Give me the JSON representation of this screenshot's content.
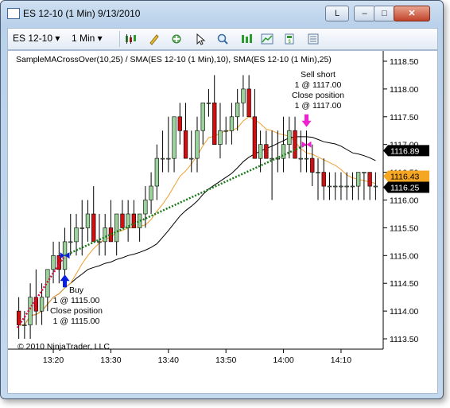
{
  "window": {
    "title": "ES 12-10 (1 Min)  9/13/2010",
    "link_label": "L",
    "min_label": "–",
    "max_label": "□",
    "close_label": "✕"
  },
  "toolbar": {
    "instrument": "ES 12-10",
    "interval": "1 Min",
    "icons": [
      "bar-type-icon",
      "pen-icon",
      "indicator-icon",
      "cursor-icon",
      "zoom-icon",
      "strategy-icon",
      "chart-icon",
      "properties-icon"
    ]
  },
  "chart": {
    "indicator_label": "SampleMACrossOver(10,25) / SMA(ES 12-10 (1 Min),10), SMA(ES 12-10 (1 Min),25)",
    "copyright": "© 2010 NinjaTrader, LLC",
    "buy_text": [
      "Buy",
      "1 @ 1115.00",
      "Close position",
      "1 @ 1115.00"
    ],
    "sell_text": [
      "Sell short",
      "1 @ 1117.00",
      "Close position",
      "1 @ 1117.00"
    ],
    "x_tick_labels": [
      "13:20",
      "13:30",
      "13:40",
      "13:50",
      "14:00",
      "14:10"
    ],
    "y_tick_labels": [
      "1118.50",
      "1118.00",
      "1117.50",
      "1117.00",
      "1116.50",
      "1116.00",
      "1115.50",
      "1115.00",
      "1114.50",
      "1114.00",
      "1113.50"
    ],
    "price_markers": [
      {
        "label": "1116.89",
        "value": 1116.89,
        "color": "#000000",
        "text_color": "#ffffff"
      },
      {
        "label": "1116.43",
        "value": 1116.43,
        "color": "#f5a623",
        "text_color": "#000000"
      },
      {
        "label": "1116.25",
        "value": 1116.25,
        "color": "#000000",
        "text_color": "#ffffff"
      }
    ],
    "colors": {
      "up": "#9bd19b",
      "down": "#d01010",
      "sma_fast": "#f0a030",
      "sma_slow": "#000000",
      "entry_line": "#1a7a1a",
      "exit_line": "#d01040",
      "buy_arrow": "#0a1ee0",
      "sell_arrow": "#f020d0"
    }
  },
  "chart_data": {
    "type": "candlestick",
    "title": "",
    "xlabel": "",
    "ylabel": "",
    "y_axis_range": [
      1113.4,
      1118.6
    ],
    "x_time_range": [
      "13:14",
      "14:17"
    ],
    "x": [
      "13:14",
      "13:15",
      "13:16",
      "13:17",
      "13:18",
      "13:19",
      "13:20",
      "13:21",
      "13:22",
      "13:23",
      "13:24",
      "13:25",
      "13:26",
      "13:27",
      "13:28",
      "13:29",
      "13:30",
      "13:31",
      "13:32",
      "13:33",
      "13:34",
      "13:35",
      "13:36",
      "13:37",
      "13:38",
      "13:39",
      "13:40",
      "13:41",
      "13:42",
      "13:43",
      "13:44",
      "13:45",
      "13:46",
      "13:47",
      "13:48",
      "13:49",
      "13:50",
      "13:51",
      "13:52",
      "13:53",
      "13:54",
      "13:55",
      "13:56",
      "13:57",
      "13:58",
      "13:59",
      "14:00",
      "14:01",
      "14:02",
      "14:03",
      "14:04",
      "14:05",
      "14:06",
      "14:07",
      "14:08",
      "14:09",
      "14:10",
      "14:11",
      "14:12",
      "14:13",
      "14:14",
      "14:15",
      "14:16"
    ],
    "open": [
      1114.0,
      1113.75,
      1113.75,
      1114.25,
      1114.0,
      1114.25,
      1114.75,
      1115.0,
      1114.75,
      1115.25,
      1115.25,
      1115.5,
      1115.5,
      1115.75,
      1115.25,
      1115.25,
      1115.5,
      1115.25,
      1115.75,
      1115.5,
      1115.75,
      1115.5,
      1115.75,
      1116.0,
      1116.25,
      1116.75,
      1116.75,
      1116.75,
      1117.5,
      1117.25,
      1116.75,
      1116.75,
      1117.25,
      1117.75,
      1117.75,
      1117.0,
      1117.25,
      1117.25,
      1117.5,
      1117.75,
      1118.0,
      1117.5,
      1116.75,
      1117.0,
      1116.75,
      1116.75,
      1116.75,
      1117.0,
      1117.25,
      1116.75,
      1116.75,
      1116.75,
      1116.5,
      1116.5,
      1116.25,
      1116.25,
      1116.25,
      1116.25,
      1116.25,
      1116.25,
      1116.5,
      1116.5,
      1116.25
    ],
    "high": [
      1114.25,
      1114.0,
      1114.5,
      1114.75,
      1114.5,
      1114.75,
      1115.25,
      1115.25,
      1115.5,
      1115.75,
      1115.75,
      1116.0,
      1116.0,
      1116.25,
      1115.75,
      1115.75,
      1116.0,
      1115.75,
      1116.0,
      1116.0,
      1116.0,
      1115.75,
      1116.25,
      1116.5,
      1117.0,
      1117.25,
      1117.5,
      1117.25,
      1117.75,
      1117.75,
      1117.25,
      1117.5,
      1117.75,
      1118.0,
      1118.25,
      1117.75,
      1117.5,
      1117.75,
      1118.0,
      1118.25,
      1118.25,
      1118.0,
      1117.25,
      1117.25,
      1117.25,
      1117.25,
      1117.5,
      1117.5,
      1117.5,
      1117.25,
      1117.25,
      1117.0,
      1116.75,
      1116.75,
      1116.5,
      1116.5,
      1116.5,
      1116.5,
      1116.5,
      1116.5,
      1116.5,
      1116.5,
      1116.5
    ],
    "low": [
      1113.5,
      1113.5,
      1113.5,
      1113.75,
      1113.75,
      1114.0,
      1114.5,
      1114.5,
      1114.5,
      1115.0,
      1115.0,
      1115.0,
      1115.25,
      1115.25,
      1115.0,
      1115.0,
      1115.25,
      1115.0,
      1115.5,
      1115.25,
      1115.5,
      1115.25,
      1115.5,
      1115.75,
      1116.0,
      1116.5,
      1116.5,
      1116.5,
      1117.0,
      1116.75,
      1116.5,
      1116.5,
      1117.0,
      1117.5,
      1117.5,
      1116.75,
      1117.0,
      1117.0,
      1117.25,
      1117.5,
      1117.75,
      1116.75,
      1116.5,
      1116.75,
      1116.0,
      1116.5,
      1116.5,
      1116.75,
      1116.75,
      1116.5,
      1116.5,
      1116.25,
      1116.0,
      1116.0,
      1116.0,
      1116.0,
      1116.0,
      1116.0,
      1116.0,
      1116.0,
      1116.0,
      1116.0,
      1116.0
    ],
    "close": [
      1113.75,
      1113.75,
      1114.25,
      1114.0,
      1114.25,
      1114.75,
      1115.0,
      1114.75,
      1115.25,
      1115.25,
      1115.5,
      1115.5,
      1115.75,
      1115.25,
      1115.25,
      1115.5,
      1115.25,
      1115.75,
      1115.5,
      1115.75,
      1115.5,
      1115.75,
      1116.0,
      1116.25,
      1116.75,
      1116.75,
      1116.75,
      1117.5,
      1117.25,
      1116.75,
      1116.75,
      1117.25,
      1117.75,
      1117.75,
      1117.0,
      1117.25,
      1117.25,
      1117.5,
      1117.75,
      1118.0,
      1117.5,
      1116.75,
      1117.0,
      1116.75,
      1116.75,
      1116.75,
      1117.0,
      1117.25,
      1116.75,
      1116.75,
      1116.75,
      1116.5,
      1116.5,
      1116.25,
      1116.25,
      1116.25,
      1116.25,
      1116.25,
      1116.25,
      1116.5,
      1116.5,
      1116.25,
      1116.25
    ],
    "sma_fast_name": "SMA(ES 12-10 (1 Min),10)",
    "sma_slow_name": "SMA(ES 12-10 (1 Min),25)",
    "trades": [
      {
        "name": "Buy",
        "time": "13:22",
        "price": 1115.0
      },
      {
        "name": "Sell short",
        "time": "14:04",
        "price": 1117.0
      }
    ],
    "grid": false
  }
}
